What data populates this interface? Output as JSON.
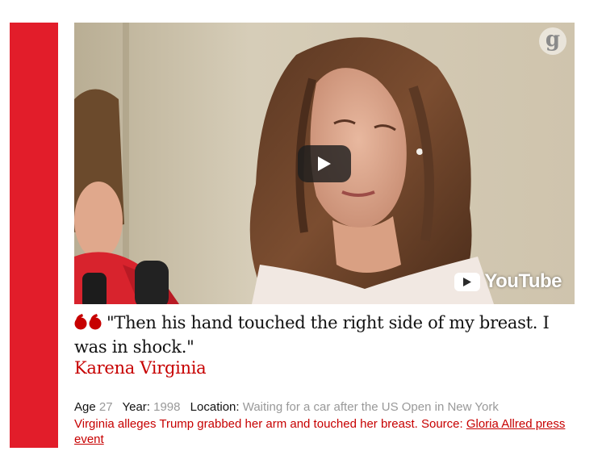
{
  "colors": {
    "accent": "#e21d2a",
    "quote_red": "#c70000",
    "meta_value_gray": "#999999",
    "text": "#121212"
  },
  "video": {
    "brand_badge": "g",
    "play_icon": "play-icon",
    "logo_text": "YouTube"
  },
  "quote": {
    "icon": "quote-marks-icon",
    "text": "\"Then his hand touched the right side of my breast. I was in shock.\"",
    "author": "Karena Virginia"
  },
  "meta": {
    "age_label": "Age",
    "age_value": "27",
    "year_label": "Year:",
    "year_value": "1998",
    "location_label": "Location:",
    "location_value": "Waiting for a car after the US Open in New York"
  },
  "description": {
    "text": "Virginia alleges Trump grabbed her arm and touched her breast. Source: ",
    "link_text": "Gloria Allred press event"
  }
}
